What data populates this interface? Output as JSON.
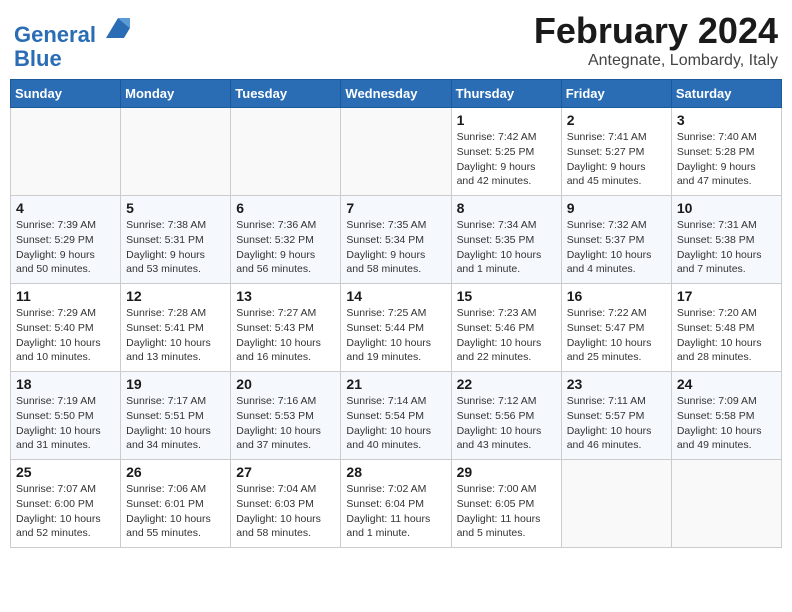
{
  "logo": {
    "line1": "General",
    "line2": "Blue"
  },
  "title": "February 2024",
  "location": "Antegnate, Lombardy, Italy",
  "days_of_week": [
    "Sunday",
    "Monday",
    "Tuesday",
    "Wednesday",
    "Thursday",
    "Friday",
    "Saturday"
  ],
  "weeks": [
    [
      {
        "day": "",
        "info": ""
      },
      {
        "day": "",
        "info": ""
      },
      {
        "day": "",
        "info": ""
      },
      {
        "day": "",
        "info": ""
      },
      {
        "day": "1",
        "info": "Sunrise: 7:42 AM\nSunset: 5:25 PM\nDaylight: 9 hours\nand 42 minutes."
      },
      {
        "day": "2",
        "info": "Sunrise: 7:41 AM\nSunset: 5:27 PM\nDaylight: 9 hours\nand 45 minutes."
      },
      {
        "day": "3",
        "info": "Sunrise: 7:40 AM\nSunset: 5:28 PM\nDaylight: 9 hours\nand 47 minutes."
      }
    ],
    [
      {
        "day": "4",
        "info": "Sunrise: 7:39 AM\nSunset: 5:29 PM\nDaylight: 9 hours\nand 50 minutes."
      },
      {
        "day": "5",
        "info": "Sunrise: 7:38 AM\nSunset: 5:31 PM\nDaylight: 9 hours\nand 53 minutes."
      },
      {
        "day": "6",
        "info": "Sunrise: 7:36 AM\nSunset: 5:32 PM\nDaylight: 9 hours\nand 56 minutes."
      },
      {
        "day": "7",
        "info": "Sunrise: 7:35 AM\nSunset: 5:34 PM\nDaylight: 9 hours\nand 58 minutes."
      },
      {
        "day": "8",
        "info": "Sunrise: 7:34 AM\nSunset: 5:35 PM\nDaylight: 10 hours\nand 1 minute."
      },
      {
        "day": "9",
        "info": "Sunrise: 7:32 AM\nSunset: 5:37 PM\nDaylight: 10 hours\nand 4 minutes."
      },
      {
        "day": "10",
        "info": "Sunrise: 7:31 AM\nSunset: 5:38 PM\nDaylight: 10 hours\nand 7 minutes."
      }
    ],
    [
      {
        "day": "11",
        "info": "Sunrise: 7:29 AM\nSunset: 5:40 PM\nDaylight: 10 hours\nand 10 minutes."
      },
      {
        "day": "12",
        "info": "Sunrise: 7:28 AM\nSunset: 5:41 PM\nDaylight: 10 hours\nand 13 minutes."
      },
      {
        "day": "13",
        "info": "Sunrise: 7:27 AM\nSunset: 5:43 PM\nDaylight: 10 hours\nand 16 minutes."
      },
      {
        "day": "14",
        "info": "Sunrise: 7:25 AM\nSunset: 5:44 PM\nDaylight: 10 hours\nand 19 minutes."
      },
      {
        "day": "15",
        "info": "Sunrise: 7:23 AM\nSunset: 5:46 PM\nDaylight: 10 hours\nand 22 minutes."
      },
      {
        "day": "16",
        "info": "Sunrise: 7:22 AM\nSunset: 5:47 PM\nDaylight: 10 hours\nand 25 minutes."
      },
      {
        "day": "17",
        "info": "Sunrise: 7:20 AM\nSunset: 5:48 PM\nDaylight: 10 hours\nand 28 minutes."
      }
    ],
    [
      {
        "day": "18",
        "info": "Sunrise: 7:19 AM\nSunset: 5:50 PM\nDaylight: 10 hours\nand 31 minutes."
      },
      {
        "day": "19",
        "info": "Sunrise: 7:17 AM\nSunset: 5:51 PM\nDaylight: 10 hours\nand 34 minutes."
      },
      {
        "day": "20",
        "info": "Sunrise: 7:16 AM\nSunset: 5:53 PM\nDaylight: 10 hours\nand 37 minutes."
      },
      {
        "day": "21",
        "info": "Sunrise: 7:14 AM\nSunset: 5:54 PM\nDaylight: 10 hours\nand 40 minutes."
      },
      {
        "day": "22",
        "info": "Sunrise: 7:12 AM\nSunset: 5:56 PM\nDaylight: 10 hours\nand 43 minutes."
      },
      {
        "day": "23",
        "info": "Sunrise: 7:11 AM\nSunset: 5:57 PM\nDaylight: 10 hours\nand 46 minutes."
      },
      {
        "day": "24",
        "info": "Sunrise: 7:09 AM\nSunset: 5:58 PM\nDaylight: 10 hours\nand 49 minutes."
      }
    ],
    [
      {
        "day": "25",
        "info": "Sunrise: 7:07 AM\nSunset: 6:00 PM\nDaylight: 10 hours\nand 52 minutes."
      },
      {
        "day": "26",
        "info": "Sunrise: 7:06 AM\nSunset: 6:01 PM\nDaylight: 10 hours\nand 55 minutes."
      },
      {
        "day": "27",
        "info": "Sunrise: 7:04 AM\nSunset: 6:03 PM\nDaylight: 10 hours\nand 58 minutes."
      },
      {
        "day": "28",
        "info": "Sunrise: 7:02 AM\nSunset: 6:04 PM\nDaylight: 11 hours\nand 1 minute."
      },
      {
        "day": "29",
        "info": "Sunrise: 7:00 AM\nSunset: 6:05 PM\nDaylight: 11 hours\nand 5 minutes."
      },
      {
        "day": "",
        "info": ""
      },
      {
        "day": "",
        "info": ""
      }
    ]
  ]
}
